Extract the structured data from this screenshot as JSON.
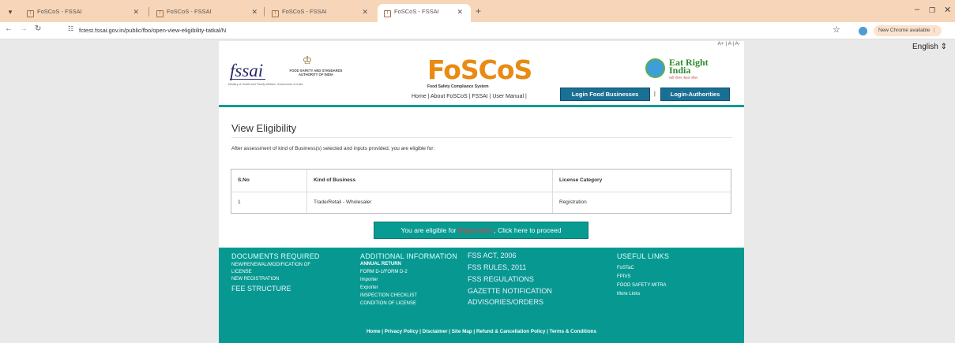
{
  "browser": {
    "tabs": [
      {
        "title": "FoSCoS - FSSAI"
      },
      {
        "title": "FoSCoS - FSSAI"
      },
      {
        "title": "FoSCoS - FSSAI"
      },
      {
        "title": "FoSCoS - FSSAI"
      }
    ],
    "url": "fctest.fssai.gov.in/public/fbo/open-view-eligibility-tatkal/N",
    "new_chrome": "New Chrome available"
  },
  "language": "English",
  "font_sizer": "A+ | A | A-",
  "header": {
    "fssai_logo": "fssai",
    "fssai_authority": "FOOD SAFETY AND STANDARDS AUTHORITY OF INDIA",
    "fssai_ministry": "Ministry of Health and Family Welfare, Government of India",
    "foscos_title": "FoSCoS",
    "foscos_subtitle": "Food Safety Compliance System",
    "erl_text": "Eat Right India",
    "erl_hindi": "सही भोजन, बेहतर जीवन",
    "nav_links": "Home | About FoSCoS | FSSAI | User Manual |",
    "login_food": "Login Food Businesses",
    "login_sep": "|",
    "login_auth": "Login-Authorities"
  },
  "main": {
    "title": "View Eligibility",
    "intro": "After assessment of kind of Business(s) selected and inputs provided, you are eligible for:",
    "table": {
      "headers": [
        "S.No",
        "Kind of Business",
        "License Category"
      ],
      "rows": [
        [
          "1",
          "Trade/Retail - Wholesaler",
          "Registration"
        ]
      ]
    },
    "eligible_prefix": "You are eligible for",
    "eligible_category": "Registration",
    "eligible_suffix": ", Click here to proceed"
  },
  "footer": {
    "col1": {
      "head": "DOCUMENTS REQUIRED",
      "items": [
        "NEW/RENEWAL/MODIFICATION OF",
        "LICENSE",
        "NEW REGISTRATION"
      ],
      "big": "FEE STRUCTURE"
    },
    "col2": {
      "head": "ADDITIONAL INFORMATION",
      "items": [
        "ANNUAL RETURN",
        "FORM D-1/FORM D-2",
        "Importer",
        "Exporter",
        "INSPECTION CHECKLIST",
        "CONDITION OF LICENSE"
      ]
    },
    "col3": {
      "items": [
        "FSS ACT, 2006",
        "FSS RULES, 2011",
        "FSS REGULATIONS",
        "GAZETTE NOTIFICATION",
        "ADVISORIES/ORDERS"
      ]
    },
    "col4": {
      "head": "USEFUL LINKS",
      "items": [
        "FoSTaC",
        "FPIVS",
        "FOOD SAFETY MITRA",
        "More Links"
      ]
    },
    "bottom": "Home | Privacy Policy | Disclaimer | Site Map | Refund & Cancellation Policy | Terms & Conditions"
  }
}
